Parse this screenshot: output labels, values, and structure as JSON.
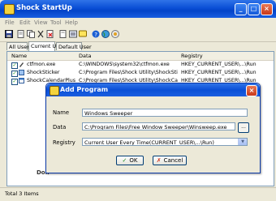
{
  "window": {
    "title": "Shock StartUp"
  },
  "menu": [
    "File",
    "Edit",
    "View",
    "Tool",
    "Help"
  ],
  "toolbar_icons": [
    "save-icon",
    "open-icon",
    "copy-icon",
    "cut-icon",
    "delete-icon",
    "add-icon",
    "properties-icon",
    "comment-icon",
    "help-icon",
    "globe-icon",
    "about-icon"
  ],
  "tabs": [
    {
      "label": "All User",
      "active": false
    },
    {
      "label": "Current User",
      "active": true
    },
    {
      "label": "Default User",
      "active": false
    }
  ],
  "list": {
    "columns": [
      "Name",
      "Data",
      "Registry"
    ],
    "rows": [
      {
        "name": "ctfmon.exe",
        "data": "C:\\WINDOWS\\system32\\ctfmon.exe",
        "registry": "HKEY_CURRENT_USER\\...\\Run",
        "checked": true
      },
      {
        "name": "ShockSticker",
        "data": "C:\\Program Files\\Shock Utility\\ShockSticke...",
        "registry": "HKEY_CURRENT_USER\\...\\Run",
        "checked": true
      },
      {
        "name": "ShockCalendarPlus",
        "data": "C:\\Program Files\\Shock Utility\\ShockCalen...",
        "registry": "HKEY_CURRENT_USER\\...\\Run",
        "checked": true
      }
    ]
  },
  "partial_label": "Don",
  "status": {
    "text": "Total 3 Items"
  },
  "dialog": {
    "title": "Add Program",
    "name_label": "Name",
    "name_value": "Windows Sweeper",
    "data_label": "Data",
    "data_value": "C:\\Program Files\\Free Window Sweeper\\Winsweep.exe",
    "browse_label": "...",
    "registry_label": "Registry",
    "registry_value": "Current User Every Time(CURRENT_USER\\...\\Run)",
    "ok_label": "OK",
    "cancel_label": "Cancel"
  },
  "colors": {
    "title_blue": "#0a4fd6",
    "close_red": "#c8381a",
    "check_green": "#21a121"
  }
}
